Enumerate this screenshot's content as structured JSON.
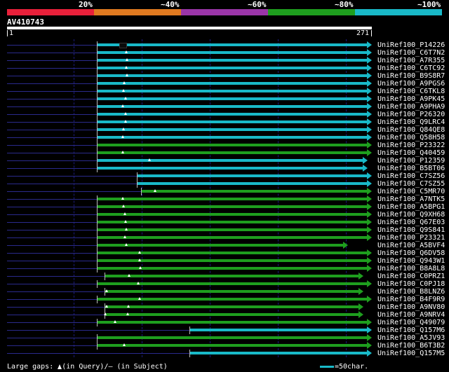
{
  "scale": {
    "labels": [
      "20%",
      "~40%",
      "~60%",
      "~80%",
      "~100%"
    ],
    "colors": [
      "#e8203a",
      "#e07a20",
      "#9a35a8",
      "#1e9e1e",
      "#19b9c8"
    ]
  },
  "query": {
    "name": "AV410743",
    "start": "1",
    "end": "271"
  },
  "hits": [
    {
      "id": "UniRef100_P14226",
      "color": "#19b9c8",
      "full": true
    },
    {
      "id": "UniRef100_C6T7N2",
      "color": "#19b9c8",
      "full": true
    },
    {
      "id": "UniRef100_A7R355",
      "color": "#19b9c8",
      "full": true
    },
    {
      "id": "UniRef100_C6TC92",
      "color": "#19b9c8",
      "full": true
    },
    {
      "id": "UniRef100_B9S8R7",
      "color": "#19b9c8",
      "full": true
    },
    {
      "id": "UniRef100_A9PGS6",
      "color": "#19b9c8",
      "full": true
    },
    {
      "id": "UniRef100_C6TKL8",
      "color": "#19b9c8",
      "full": true
    },
    {
      "id": "UniRef100_A9PK45",
      "color": "#19b9c8",
      "full": true
    },
    {
      "id": "UniRef100_A9PHA9",
      "color": "#19b9c8",
      "full": true
    },
    {
      "id": "UniRef100_P26320",
      "color": "#19b9c8",
      "full": true
    },
    {
      "id": "UniRef100_Q9LRC4",
      "color": "#19b9c8",
      "full": true
    },
    {
      "id": "UniRef100_Q84QE8",
      "color": "#19b9c8",
      "full": true
    },
    {
      "id": "UniRef100_Q58H58",
      "color": "#19b9c8",
      "full": true
    },
    {
      "id": "UniRef100_P23322",
      "color": "#1e9e1e",
      "full": true
    },
    {
      "id": "UniRef100_Q40459",
      "color": "#1e9e1e",
      "full": true
    },
    {
      "id": "UniRef100_P12359",
      "color": "#19b9c8",
      "full": true
    },
    {
      "id": "UniRef100_B5BT06",
      "color": "#19b9c8",
      "full": true
    },
    {
      "id": "UniRef100_C7SZ56",
      "color": "#19b9c8",
      "full": true
    },
    {
      "id": "UniRef100_C7SZ55",
      "color": "#19b9c8",
      "full": true
    },
    {
      "id": "UniRef100_C5MR70",
      "color": "#1e9e1e",
      "full": true
    },
    {
      "id": "UniRef100_A7NTK5",
      "color": "#1e9e1e",
      "full": true
    },
    {
      "id": "UniRef100_A5BPG1",
      "color": "#1e9e1e",
      "full": true
    },
    {
      "id": "UniRef100_Q9XH68",
      "color": "#1e9e1e",
      "full": true
    },
    {
      "id": "UniRef100_Q67E03",
      "color": "#1e9e1e",
      "full": true
    },
    {
      "id": "UniRef100_Q9S841",
      "color": "#1e9e1e",
      "full": true
    },
    {
      "id": "UniRef100_P23321",
      "color": "#1e9e1e",
      "full": true
    },
    {
      "id": "UniRef100_A5BVF4",
      "color": "#1e9e1e",
      "full": false
    },
    {
      "id": "UniRef100_Q6DV58",
      "color": "#1e9e1e",
      "full": true
    },
    {
      "id": "UniRef100_Q943W1",
      "color": "#1e9e1e",
      "full": true
    },
    {
      "id": "UniRef100_B8A8L8",
      "color": "#1e9e1e",
      "full": true
    },
    {
      "id": "UniRef100_C0PRZ1",
      "color": "#1e9e1e",
      "full": false
    },
    {
      "id": "UniRef100_C0PJ18",
      "color": "#1e9e1e",
      "full": true
    },
    {
      "id": "UniRef100_B8LNZ6",
      "color": "#1e9e1e",
      "full": false
    },
    {
      "id": "UniRef100_B4F9R9",
      "color": "#1e9e1e",
      "full": true
    },
    {
      "id": "UniRef100_A9NV80",
      "color": "#1e9e1e",
      "full": false
    },
    {
      "id": "UniRef100_A9NRV4",
      "color": "#1e9e1e",
      "full": false
    },
    {
      "id": "UniRef100_Q49079",
      "color": "#1e9e1e",
      "full": true
    },
    {
      "id": "UniRef100_Q157M6",
      "color": "#19b9c8",
      "full": true
    },
    {
      "id": "UniRef100_A5JV93",
      "color": "#1e9e1e",
      "full": true
    },
    {
      "id": "UniRef100_B6T3B2",
      "color": "#1e9e1e",
      "full": true
    },
    {
      "id": "UniRef100_Q157M5",
      "color": "#19b9c8",
      "full": true
    }
  ],
  "footer": {
    "gaps_prefix": "Large gaps: ",
    "gaps_query": "(in Query)/",
    "gaps_subject": "– (in Subject)",
    "scale_label": "=50char."
  }
}
